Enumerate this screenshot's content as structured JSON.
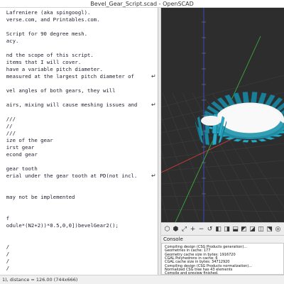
{
  "window": {
    "title": "Bevel_Gear_Script.scad - OpenSCAD"
  },
  "editor": {
    "lines": [
      "  Lafreniere (aka spingoogl).",
      "  verse.com, and Printables.com.",
      "",
      "  Script for 90 degree mesh.",
      "  acy.",
      "",
      "  nd the scope of this script.",
      "  items that I will cover.",
      "  have a variable pitch diameter.",
      "  measured at the largest pitch diameter of",
      "",
      "  vel angles of both gears, they will",
      "",
      "  airs, mixing will cause meshing issues and",
      "",
      "  ///",
      "  //",
      "  ///",
      "  ize of the gear",
      "  irst gear",
      "  econd gear",
      "",
      "  gear tooth",
      "  erial under the gear tooth at PD(not incl.",
      "",
      "",
      "  may not be implemented",
      "",
      "",
      "  f",
      "  odule*(N2+2))*0.5,0,0])bevelGear2();",
      "",
      "",
      "  /",
      "  /",
      "  /",
      "  /"
    ],
    "wrap_marker": "↵"
  },
  "toolbar": {
    "icons": [
      "preview-cube-icon",
      "render-cube-icon",
      "zoom-all-icon",
      "zoom-in-icon",
      "zoom-out-icon",
      "reset-view-icon",
      "view-right-icon",
      "view-top-icon",
      "view-bottom-icon",
      "view-left-icon",
      "view-front-icon",
      "view-back-icon",
      "view-diagonal-icon",
      "view-center-icon"
    ]
  },
  "console": {
    "title": "Console",
    "lines": [
      "Compiling design (CSG Products generation)...",
      "Geometries in cache: 177",
      "Geometry cache size in bytes: 1916720",
      "CGAL Polyhedrons in cache: 6",
      "CGAL cache size in bytes: 34712920",
      "Compiling design (CSG Products normalization)...",
      "Normalized CSG tree has 43 elements",
      "Compile and preview finished."
    ]
  },
  "status": {
    "text": "1), distance = 126.00 (744x666)"
  },
  "colors": {
    "viewport_bg": "#2d2d2d",
    "gear_face": "#29aac6",
    "gear_hub": "#f4f4f4",
    "axis_red": "#c83c3c",
    "axis_green": "#3caa3c",
    "axis_blue": "#3c50c8"
  }
}
